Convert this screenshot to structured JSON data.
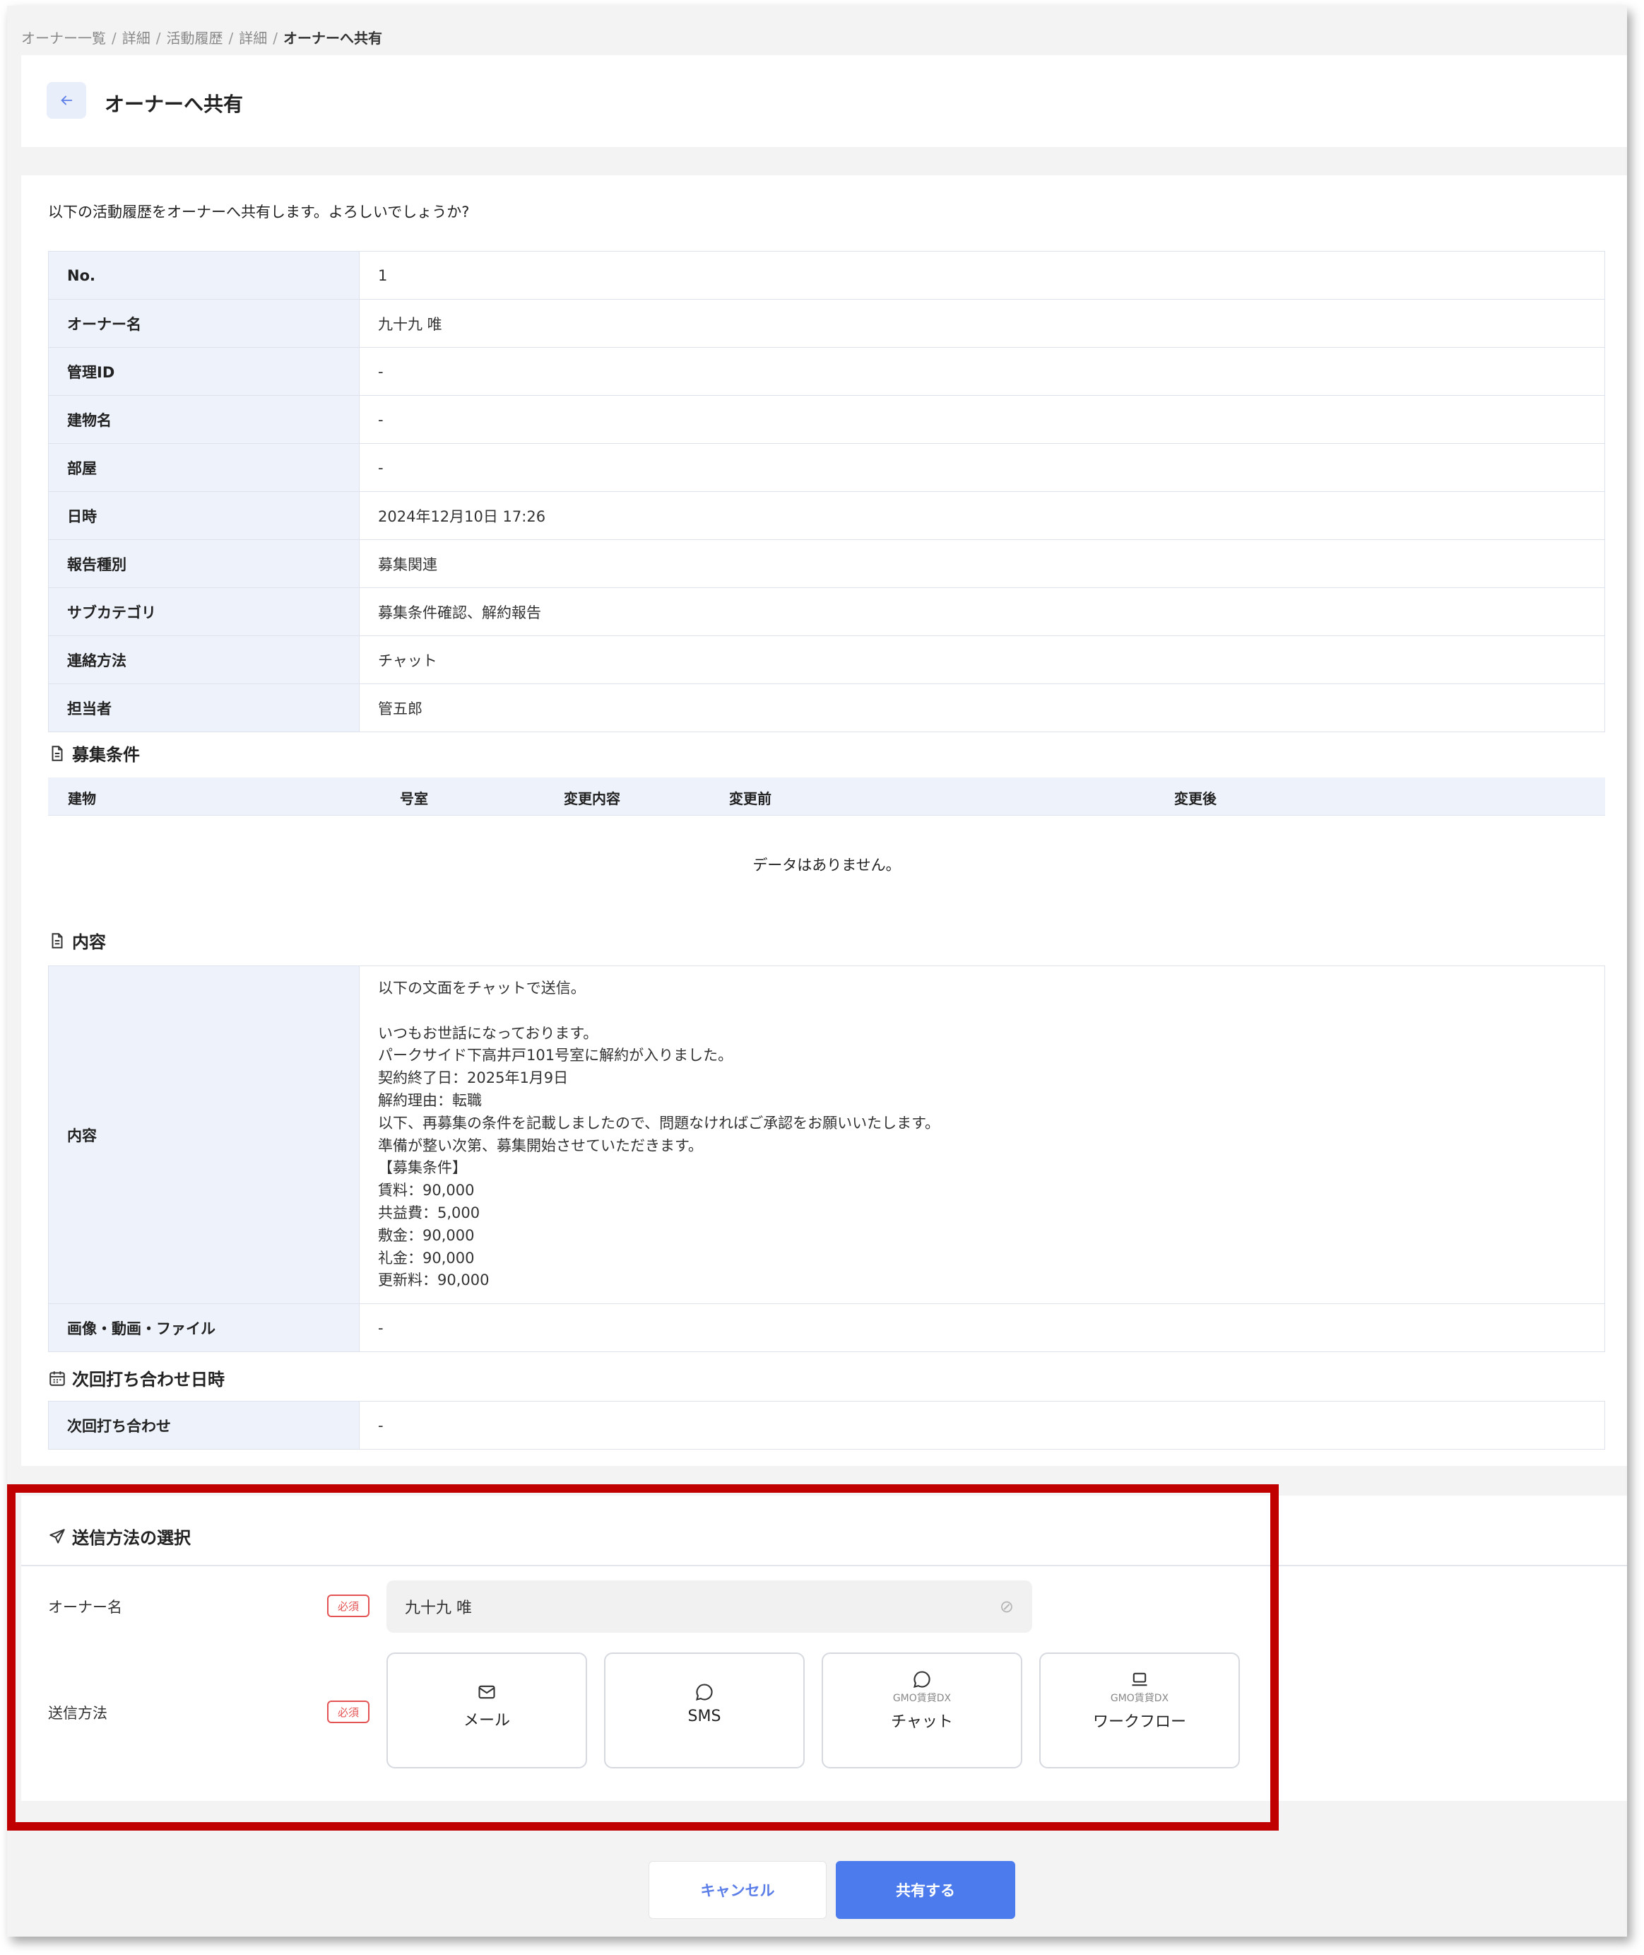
{
  "breadcrumb": {
    "items": [
      "オーナー一覧",
      "詳細",
      "活動履歴",
      "詳細"
    ],
    "current": "オーナーへ共有",
    "separator": "/"
  },
  "header": {
    "back_icon": "arrow-left-icon",
    "title": "オーナーへ共有"
  },
  "intro": "以下の活動履歴をオーナーへ共有します。よろしいでしょうか?",
  "info_table": [
    {
      "label": "No.",
      "value": "1"
    },
    {
      "label": "オーナー名",
      "value": "九十九 唯"
    },
    {
      "label": "管理ID",
      "value": "-"
    },
    {
      "label": "建物名",
      "value": "-"
    },
    {
      "label": "部屋",
      "value": "-"
    },
    {
      "label": "日時",
      "value": "2024年12月10日 17:26"
    },
    {
      "label": "報告種別",
      "value": "募集関連"
    },
    {
      "label": "サブカテゴリ",
      "value": "募集条件確認、解約報告"
    },
    {
      "label": "連絡方法",
      "value": "チャット"
    },
    {
      "label": "担当者",
      "value": "管五郎"
    }
  ],
  "recruit_section": {
    "title": "募集条件",
    "icon": "document-icon",
    "columns": [
      "建物",
      "号室",
      "変更内容",
      "変更前",
      "変更後"
    ],
    "empty_text": "データはありません。"
  },
  "content_section": {
    "title": "内容",
    "icon": "document-icon",
    "label": "内容",
    "lines": [
      "以下の文面をチャットで送信。",
      "",
      "いつもお世話になっております。",
      "パークサイド下高井戸101号室に解約が入りました。",
      "契約終了日：2025年1月9日",
      "解約理由：転職",
      "以下、再募集の条件を記載しましたので、問題なければご承認をお願いいたします。",
      "準備が整い次第、募集開始させていただきます。",
      "【募集条件】",
      "賃料：90,000",
      "共益費：5,000",
      "敷金：90,000",
      "礼金：90,000",
      "更新料：90,000"
    ],
    "media_label": "画像・動画・ファイル",
    "media_value": "-"
  },
  "next_meeting_section": {
    "title": "次回打ち合わせ日時",
    "icon": "calendar-icon",
    "label": "次回打ち合わせ",
    "value": "-"
  },
  "send_section": {
    "title": "送信方法の選択",
    "icon": "send-icon",
    "owner_label": "オーナー名",
    "required_badge": "必須",
    "owner_value": "九十九 唯",
    "owner_disabled_icon": "ban-icon",
    "method_label": "送信方法",
    "methods": [
      {
        "icon": "mail-icon",
        "sub": "",
        "label": "メール"
      },
      {
        "icon": "chat-bubble-icon",
        "sub": "",
        "label": "SMS"
      },
      {
        "icon": "chat-bubble-icon",
        "sub": "GMO賃貸DX",
        "label": "チャット"
      },
      {
        "icon": "laptop-icon",
        "sub": "GMO賃貸DX",
        "label": "ワークフロー"
      }
    ]
  },
  "footer": {
    "cancel_label": "キャンセル",
    "share_label": "共有する"
  },
  "colors": {
    "accent": "#4b7bec",
    "header_bg": "#eef2fb",
    "required": "#e45454",
    "highlight_box": "#c00000"
  }
}
